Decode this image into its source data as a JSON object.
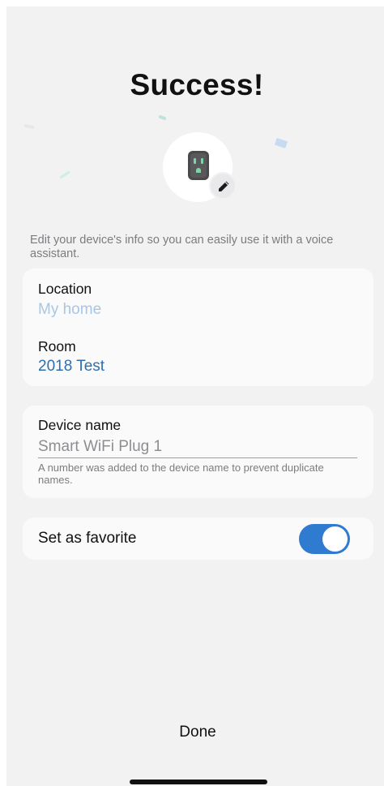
{
  "header": {
    "title": "Success!"
  },
  "device": {
    "icon": "smart-plug-icon",
    "edit_icon": "pencil-icon"
  },
  "helper_text": "Edit your device's info so you can easily use it with a voice assistant.",
  "location_card": {
    "location_label": "Location",
    "location_value": "My home",
    "room_label": "Room",
    "room_value": "2018 Test"
  },
  "name_card": {
    "label": "Device name",
    "placeholder": "Smart WiFi Plug 1",
    "value": "",
    "note": "A number was added to the device name to prevent duplicate names."
  },
  "favorite_card": {
    "label": "Set as favorite",
    "toggle_on": true
  },
  "footer": {
    "done_label": "Done"
  },
  "colors": {
    "accent": "#2e7bd0",
    "link_blue": "#2e6fb3",
    "disabled_blue": "#a9c6e2",
    "background": "#f2f2f2"
  }
}
